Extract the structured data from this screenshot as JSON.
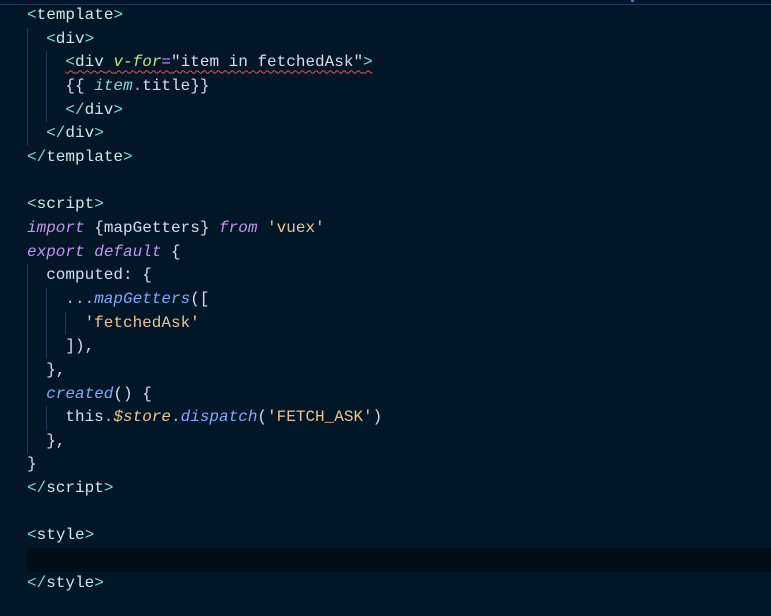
{
  "editor": {
    "current_line": 24,
    "squiggle_line": 3,
    "lines": [
      {
        "indent": 0,
        "tokens": [
          [
            "<",
            "punct"
          ],
          [
            "template",
            "tag"
          ],
          [
            ">",
            "punct"
          ]
        ]
      },
      {
        "indent": 1,
        "tokens": [
          [
            "<",
            "punct"
          ],
          [
            "div",
            "tag"
          ],
          [
            ">",
            "punct"
          ]
        ]
      },
      {
        "indent": 2,
        "tokens": [
          [
            "<",
            "punct"
          ],
          [
            "div",
            "tag"
          ],
          [
            " ",
            "text"
          ],
          [
            "v-for",
            "attr"
          ],
          [
            "=",
            "eq"
          ],
          [
            "\"item in fetchedAsk\"",
            "text"
          ],
          [
            ">",
            "punct"
          ]
        ]
      },
      {
        "indent": 2,
        "tokens": [
          [
            "{{ ",
            "text"
          ],
          [
            "item",
            "var"
          ],
          [
            ".",
            "op"
          ],
          [
            "title",
            "text"
          ],
          [
            "}}",
            "text"
          ]
        ]
      },
      {
        "indent": 2,
        "tokens": [
          [
            "</",
            "punct"
          ],
          [
            "div",
            "tag"
          ],
          [
            ">",
            "punct"
          ]
        ]
      },
      {
        "indent": 1,
        "tokens": [
          [
            "</",
            "punct"
          ],
          [
            "div",
            "tag"
          ],
          [
            ">",
            "punct"
          ]
        ]
      },
      {
        "indent": 0,
        "tokens": [
          [
            "</",
            "punct"
          ],
          [
            "template",
            "tag"
          ],
          [
            ">",
            "punct"
          ]
        ]
      },
      {
        "indent": 0,
        "tokens": []
      },
      {
        "indent": 0,
        "tokens": [
          [
            "<",
            "punct"
          ],
          [
            "script",
            "tag"
          ],
          [
            ">",
            "punct"
          ]
        ]
      },
      {
        "indent": 0,
        "tokens": [
          [
            "import",
            "kw"
          ],
          [
            " {mapGetters} ",
            "text"
          ],
          [
            "from",
            "kw"
          ],
          [
            " ",
            "text"
          ],
          [
            "'vuex'",
            "str"
          ]
        ]
      },
      {
        "indent": 0,
        "tokens": [
          [
            "export",
            "kw"
          ],
          [
            " ",
            "text"
          ],
          [
            "default",
            "kw"
          ],
          [
            " {",
            "text"
          ]
        ]
      },
      {
        "indent": 1,
        "tokens": [
          [
            "computed: {",
            "text"
          ]
        ]
      },
      {
        "indent": 2,
        "tokens": [
          [
            "...",
            "punct"
          ],
          [
            "mapGetters",
            "fn"
          ],
          [
            "([",
            "text"
          ]
        ]
      },
      {
        "indent": 3,
        "tokens": [
          [
            "'fetchedAsk'",
            "str"
          ]
        ]
      },
      {
        "indent": 2,
        "tokens": [
          [
            "]),",
            "text"
          ]
        ]
      },
      {
        "indent": 1,
        "tokens": [
          [
            "},",
            "text"
          ]
        ]
      },
      {
        "indent": 1,
        "tokens": [
          [
            "created",
            "fn"
          ],
          [
            "() {",
            "text"
          ]
        ]
      },
      {
        "indent": 2,
        "tokens": [
          [
            "this",
            "this"
          ],
          [
            ".",
            "punct"
          ],
          [
            "$store",
            "store"
          ],
          [
            ".",
            "punct"
          ],
          [
            "dispatch",
            "fn"
          ],
          [
            "(",
            "text"
          ],
          [
            "'FETCH_ASK'",
            "str"
          ],
          [
            ")",
            "text"
          ]
        ]
      },
      {
        "indent": 1,
        "tokens": [
          [
            "},",
            "text"
          ]
        ]
      },
      {
        "indent": 0,
        "tokens": [
          [
            "}",
            "text"
          ]
        ]
      },
      {
        "indent": 0,
        "tokens": [
          [
            "</",
            "punct"
          ],
          [
            "script",
            "tag"
          ],
          [
            ">",
            "punct"
          ]
        ]
      },
      {
        "indent": 0,
        "tokens": []
      },
      {
        "indent": 0,
        "tokens": [
          [
            "<",
            "punct"
          ],
          [
            "style",
            "tag"
          ],
          [
            ">",
            "punct"
          ]
        ]
      },
      {
        "indent": 0,
        "tokens": []
      },
      {
        "indent": 0,
        "tokens": [
          [
            "</",
            "punct"
          ],
          [
            "style",
            "tag"
          ],
          [
            ">",
            "punct"
          ]
        ]
      }
    ]
  }
}
